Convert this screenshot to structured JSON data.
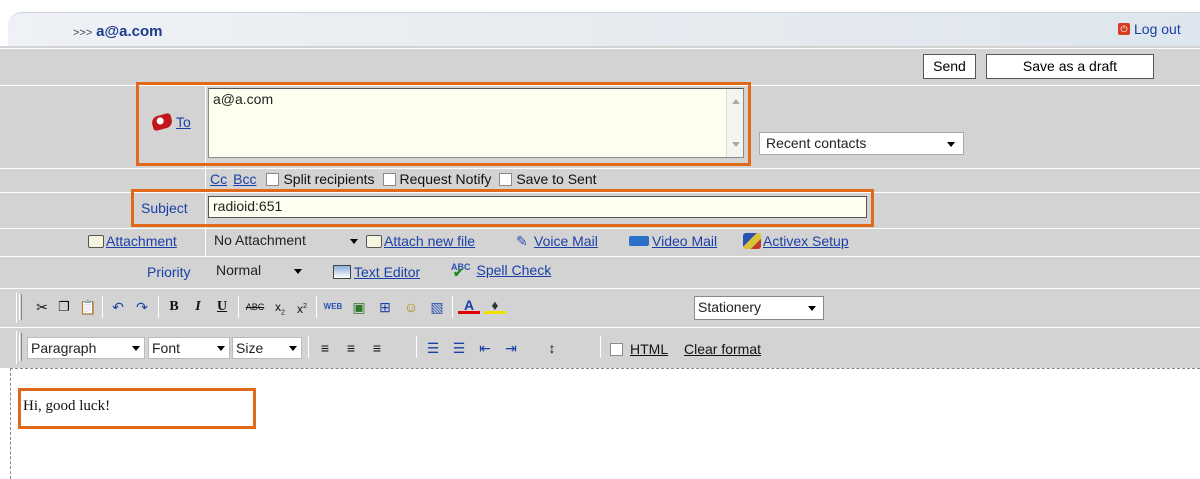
{
  "header": {
    "prefix": ">>>",
    "email": "a@a.com",
    "logout": "Log out"
  },
  "actions": {
    "send": "Send",
    "draft": "Save as a draft"
  },
  "to": {
    "label": "To",
    "value": "a@a.com"
  },
  "recent": {
    "value": "Recent contacts"
  },
  "options": {
    "cc": "Cc",
    "bcc": "Bcc",
    "split": "Split recipients",
    "notify": "Request Notify",
    "save_sent": "Save to Sent"
  },
  "subject": {
    "label": "Subject",
    "value": "radioid:651"
  },
  "attachment": {
    "label": "Attachment",
    "select": "No Attachment",
    "attach_new": "Attach new file",
    "voice": "Voice Mail",
    "video": "Video Mail",
    "activex": "Activex Setup"
  },
  "priority": {
    "label": "Priority",
    "value": "Normal",
    "text_editor": "Text Editor",
    "spell": "Spell Check"
  },
  "toolbar": {
    "stationery": "Stationery",
    "paragraph": "Paragraph",
    "font": "Font",
    "size": "Size",
    "html": "HTML",
    "clear": "Clear format"
  },
  "body": {
    "text": "Hi, good luck!"
  },
  "colors": {
    "highlight": "#e06a1a",
    "row_bg": "#d3d3d3",
    "link": "#1a3fa6"
  }
}
